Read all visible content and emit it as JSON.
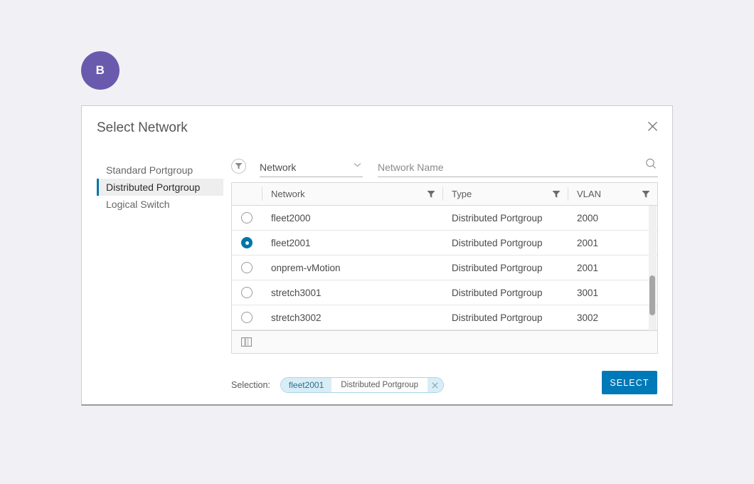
{
  "avatar": {
    "initial": "B"
  },
  "dialog": {
    "title": "Select Network",
    "close_label": "Close"
  },
  "sidebar": {
    "items": [
      {
        "label": "Standard Portgroup",
        "selected": false
      },
      {
        "label": "Distributed Portgroup",
        "selected": true
      },
      {
        "label": "Logical Switch",
        "selected": false
      }
    ]
  },
  "filter_bar": {
    "funnel_icon": "filter-funnel-icon",
    "field_select": {
      "value": "Network",
      "chevron_icon": "chevron-down-icon"
    },
    "search": {
      "value": "",
      "placeholder": "Network Name",
      "icon": "search-icon"
    }
  },
  "table": {
    "columns": [
      {
        "key": "select",
        "label": ""
      },
      {
        "key": "network",
        "label": "Network"
      },
      {
        "key": "type",
        "label": "Type"
      },
      {
        "key": "vlan",
        "label": "VLAN"
      }
    ],
    "rows": [
      {
        "network": "fleet2000",
        "type": "Distributed Portgroup",
        "vlan": "2000",
        "selected": false
      },
      {
        "network": "fleet2001",
        "type": "Distributed Portgroup",
        "vlan": "2001",
        "selected": true
      },
      {
        "network": "onprem-vMotion",
        "type": "Distributed Portgroup",
        "vlan": "2001",
        "selected": false
      },
      {
        "network": "stretch3001",
        "type": "Distributed Portgroup",
        "vlan": "3001",
        "selected": false
      },
      {
        "network": "stretch3002",
        "type": "Distributed Portgroup",
        "vlan": "3002",
        "selected": false
      }
    ],
    "footer": {
      "column_picker_icon": "column-picker-icon"
    }
  },
  "footer": {
    "selection_caption": "Selection:",
    "chip": {
      "name": "fleet2001",
      "type": "Distributed Portgroup",
      "remove_label": "Remove"
    },
    "select_button": "SELECT"
  },
  "colors": {
    "page_bg": "#f1f0f5",
    "avatar_bg": "#6a5aad",
    "accent_blue": "#0076a8",
    "primary_button": "#0079b8",
    "chip_bg": "#d9edf7"
  }
}
